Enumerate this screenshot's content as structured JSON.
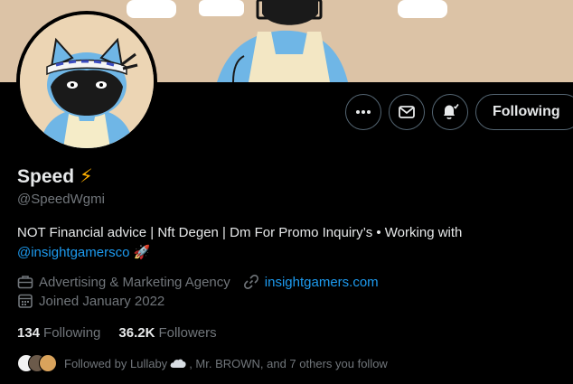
{
  "profile": {
    "name": "Speed",
    "name_emoji": "⚡",
    "handle": "@SpeedWgmi",
    "bio_text": "NOT Financial advice | Nft Degen | Dm For Promo Inquiry’s • Working with",
    "bio_link": "@insightgamersco",
    "bio_emoji": "🚀",
    "category": "Advertising & Marketing Agency",
    "website": "insightgamers.com",
    "joined": "Joined January 2022"
  },
  "stats": {
    "following_count": "134",
    "following_label": "Following",
    "followers_count": "36.2K",
    "followers_label": "Followers"
  },
  "actions": {
    "following_button": "Following"
  },
  "followed_by": {
    "text_prefix": "Followed by Lullaby",
    "text_suffix": ", Mr. BROWN, and 7 others you follow"
  },
  "icons": {
    "more": "more-icon",
    "message": "envelope-icon",
    "notifications": "bell-icon",
    "category": "briefcase-icon",
    "website": "link-icon",
    "joined": "calendar-icon"
  },
  "colors": {
    "background": "#000000",
    "text_primary": "#e7e9ea",
    "text_secondary": "#71767b",
    "link": "#1d9bf0",
    "banner": "#dcc3a6",
    "lightning": "#ffb000"
  }
}
